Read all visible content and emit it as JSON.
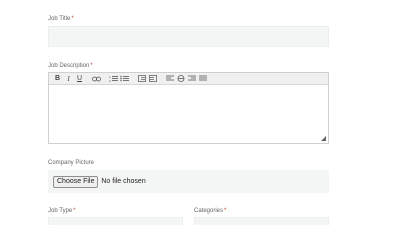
{
  "form": {
    "job_title": {
      "label": "Job Title",
      "required_mark": "*",
      "value": ""
    },
    "job_description": {
      "label": "Job Description",
      "required_mark": "*",
      "toolbar": [
        "bold-icon",
        "italic-icon",
        "underline-icon",
        "link-icon",
        "numbered-list-icon",
        "bulleted-list-icon",
        "outdent-icon",
        "indent-icon",
        "align-left-icon",
        "align-center-icon",
        "align-right-icon",
        "align-justify-icon"
      ],
      "toolbar_glyphs": {
        "bold": "B",
        "italic": "I",
        "underline": "U"
      },
      "value": ""
    },
    "company_picture": {
      "label": "Company Picture",
      "button_label": "Choose File",
      "status": "No file chosen"
    },
    "job_type": {
      "label": "Job Type",
      "required_mark": "*",
      "value": ""
    },
    "categories": {
      "label": "Categories",
      "required_mark": "*",
      "value": ""
    }
  },
  "colors": {
    "field_bg": "#f4f6f5",
    "required": "#c0392b",
    "label": "#666666"
  }
}
